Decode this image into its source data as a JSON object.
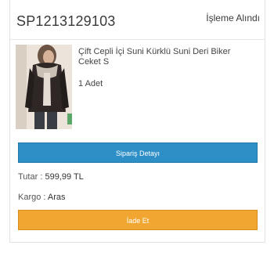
{
  "order": {
    "id": "SP1213129103",
    "status": "İşleme Alındı"
  },
  "product": {
    "name": "Çift Cepli İçi Suni Kürklü Suni Deri Biker Ceket S",
    "quantity": "1 Adet",
    "image_alt": "product-photo"
  },
  "buttons": {
    "detail_label": "Sipariş Detayı",
    "return_label": "İade Et"
  },
  "summary": {
    "amount_label": "Tutar :",
    "amount_value": "599,99 TL",
    "cargo_label": "Kargo :",
    "cargo_value": "Aras"
  },
  "colors": {
    "detail_button": "#2e8fc6",
    "return_button": "#f0a631"
  }
}
